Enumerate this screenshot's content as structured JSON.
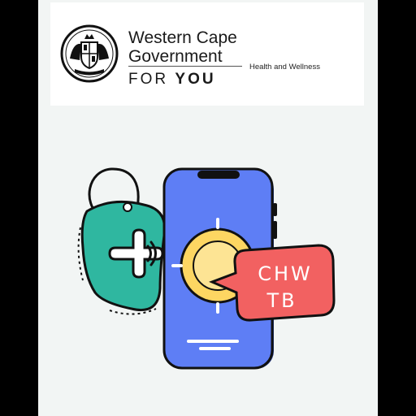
{
  "brand": {
    "org_line1": "Western Cape",
    "org_line2": "Government",
    "department": "Health and Wellness",
    "tagline_word1": "FOR",
    "tagline_word2": "YOU"
  },
  "illustration": {
    "badge_line1": "CHW",
    "badge_line2": "TB",
    "icons": [
      "coat-of-arms-icon",
      "smartphone-icon",
      "medical-cross-icon",
      "sun-icon",
      "speech-bubble-icon"
    ],
    "colors": {
      "phone_screen": "#5e7ef5",
      "tag_green": "#2fb7a0",
      "sun_yellow": "#fdd662",
      "bubble_red": "#f26161",
      "outline": "#111111"
    }
  }
}
